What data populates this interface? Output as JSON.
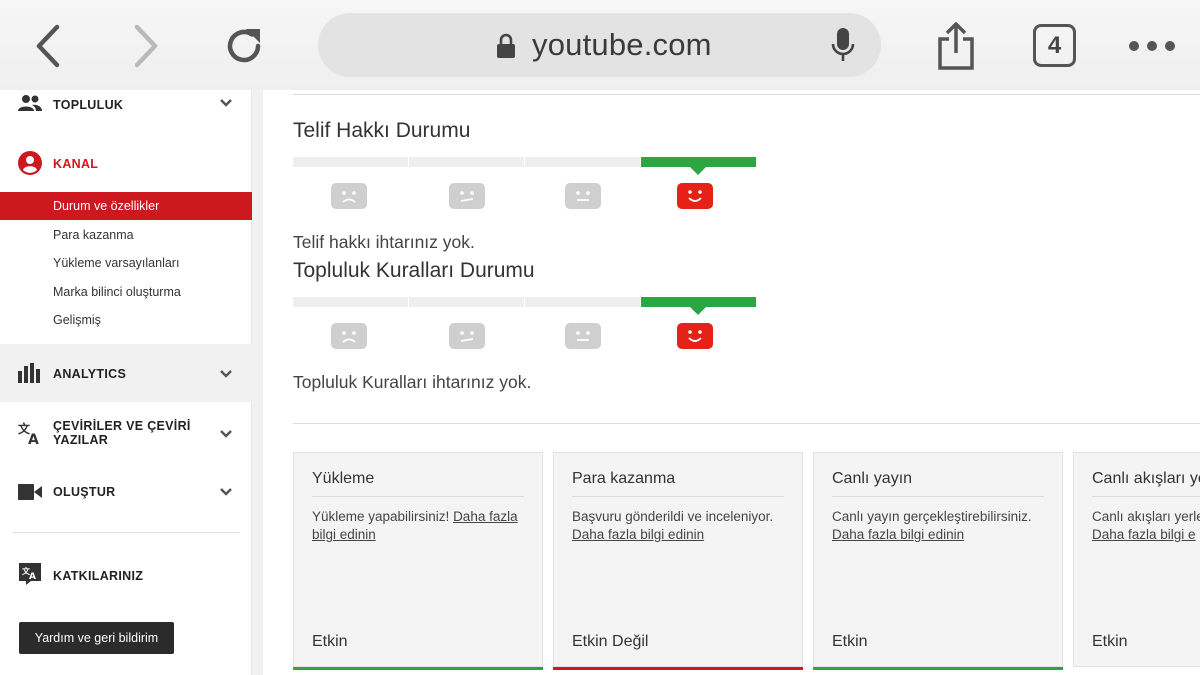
{
  "browser": {
    "url": "youtube.com",
    "tab_count": "4",
    "icons": [
      "back-icon",
      "forward-icon",
      "reload-icon",
      "lock-icon",
      "mic-icon",
      "share-icon",
      "more-icon"
    ]
  },
  "sidebar": {
    "topluluk": "TOPLULUK",
    "kanal": "KANAL",
    "kanal_items": [
      {
        "label": "Durum ve özellikler",
        "active": true
      },
      {
        "label": "Para kazanma"
      },
      {
        "label": "Yükleme varsayılanları"
      },
      {
        "label": "Marka bilinci oluşturma"
      },
      {
        "label": "Gelişmiş"
      }
    ],
    "analytics": "ANALYTICS",
    "ceviriler_line1": "ÇEVİRİLER VE ÇEVİRİ",
    "ceviriler_line2": "YAZILAR",
    "olustur": "OLUŞTUR",
    "katkilariniz": "KATKILARINIZ",
    "help_button": "Yardım ve geri bildirim",
    "accent_color": "#cc181e"
  },
  "main": {
    "copyright": {
      "title": "Telif Hakkı Durumu",
      "status_level": 4,
      "text": "Telif hakkı ihtarınız yok."
    },
    "community": {
      "title": "Topluluk Kuralları Durumu",
      "status_level": 4,
      "text": "Topluluk Kuralları ihtarınız yok."
    },
    "cards": [
      {
        "title": "Yükleme",
        "body": "Yükleme yapabilirsiniz! ",
        "link": "Daha fazla bilgi edinin",
        "status": "Etkin",
        "status_color": "#2ba640"
      },
      {
        "title": "Para kazanma",
        "body": "Başvuru gönderildi ve inceleniyor. ",
        "link": "Daha fazla bilgi edinin",
        "status": "Etkin Değil",
        "status_color": "#cc181e"
      },
      {
        "title": "Canlı yayın",
        "body": "Canlı yayın gerçekleştirebilirsiniz. ",
        "link": "Daha fazla bilgi edinin",
        "status": "Etkin",
        "status_color": "#2ba640"
      },
      {
        "title": "Canlı akışları ye",
        "body": "Canlı akışları yerle",
        "link": "Daha fazla bilgi e",
        "status": "Etkin",
        "status_color": "#2ba640"
      }
    ]
  }
}
